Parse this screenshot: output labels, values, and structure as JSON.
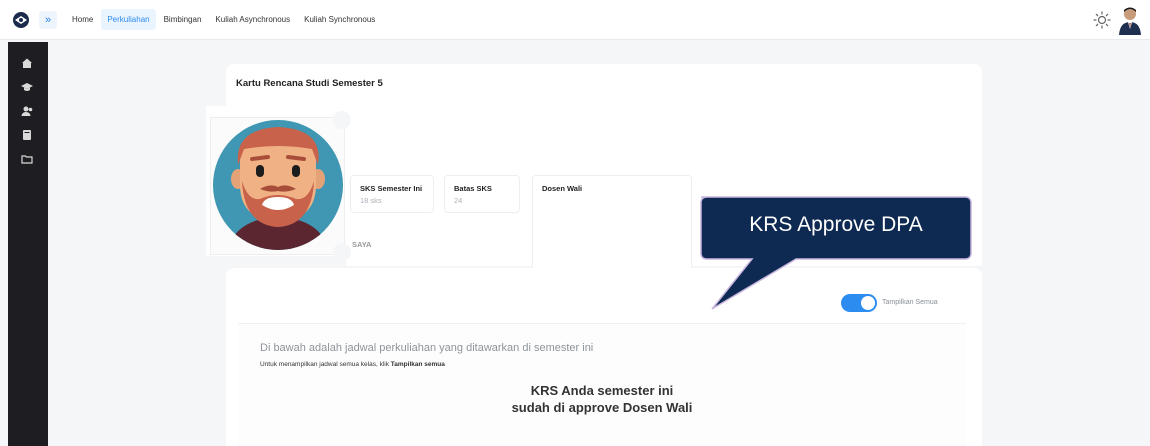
{
  "header": {
    "nav": [
      {
        "label": "Home",
        "active": false
      },
      {
        "label": "Perkuliahan",
        "active": true
      },
      {
        "label": "Bimbingan",
        "active": false
      },
      {
        "label": "Kuliah Asynchronous",
        "active": false
      },
      {
        "label": "Kuliah Synchronous",
        "active": false
      }
    ],
    "toggle_icon": "chevrons-right-icon",
    "theme_icon": "sun-icon",
    "accent": "#2d8cf0"
  },
  "sidebar": {
    "items": [
      {
        "icon": "home-icon"
      },
      {
        "icon": "graduation-cap-icon"
      },
      {
        "icon": "users-icon"
      },
      {
        "icon": "book-icon"
      },
      {
        "icon": "folder-icon"
      }
    ]
  },
  "krs_card": {
    "title": "Kartu Rencana Studi Semester 5",
    "stats": [
      {
        "label": "SKS Semester Ini",
        "value": "18 sks"
      },
      {
        "label": "Batas SKS",
        "value": "24"
      }
    ],
    "dosen_label": "Dosen Wali",
    "saya_label": "SAYA"
  },
  "schedule": {
    "toggle_label": "Tampilkan Semua",
    "toggle_on": true,
    "info_title": "Di bawah adalah jadwal perkuliahan yang ditawarkan di semester ini",
    "info_sub_prefix": "Untuk menampilkan jadwal semua kelas, klik ",
    "info_sub_bold": "Tampilkan semua",
    "approved_line1": "KRS Anda semester ini",
    "approved_line2": "sudah di approve Dosen Wali"
  },
  "callout": {
    "text": "KRS Approve DPA",
    "fill": "#0f2a52",
    "border": "#c8b6de"
  }
}
